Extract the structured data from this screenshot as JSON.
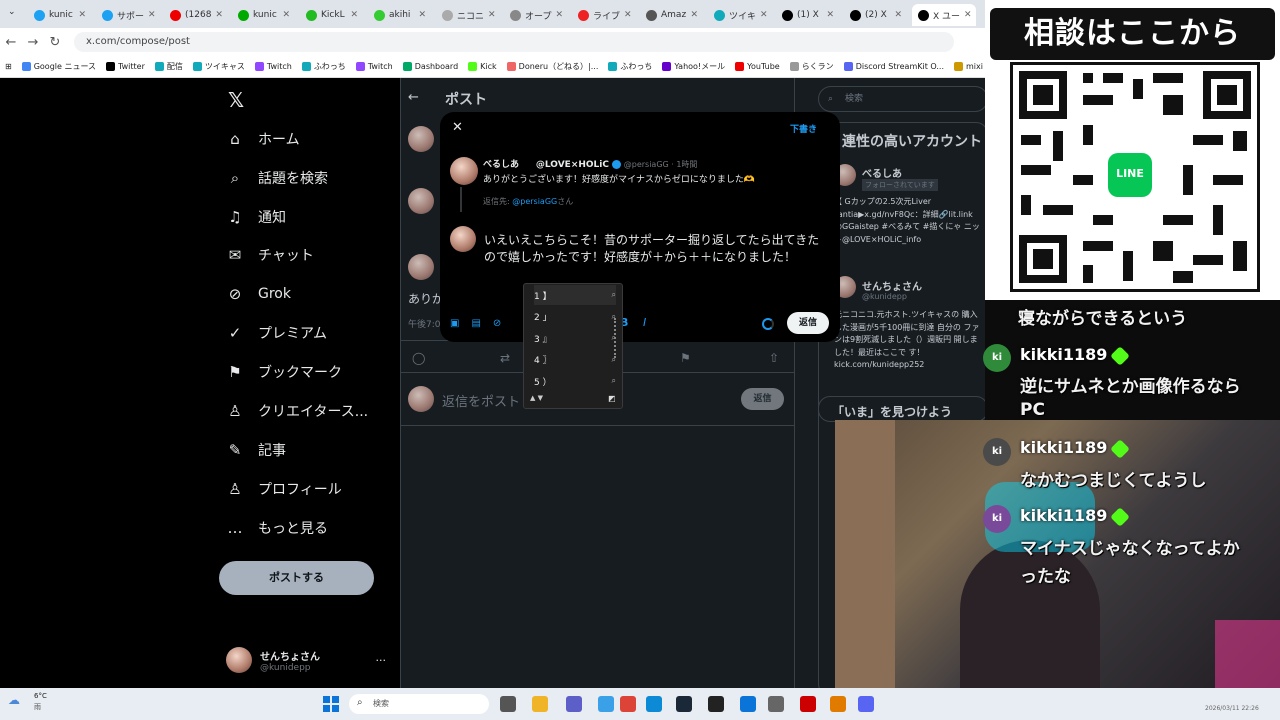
{
  "browser": {
    "tabs": [
      {
        "label": "kunic",
        "color": "#1da1f2"
      },
      {
        "label": "サポー",
        "color": "#1da1f2"
      },
      {
        "label": "(1268",
        "color": "#e00"
      },
      {
        "label": "kunic",
        "color": "#0a0"
      },
      {
        "label": "KickL",
        "color": "#2b2"
      },
      {
        "label": "akihi",
        "color": "#3c3"
      },
      {
        "label": "ニコニ",
        "color": "#aaa"
      },
      {
        "label": "オープ",
        "color": "#888"
      },
      {
        "label": "ライブ",
        "color": "#e22"
      },
      {
        "label": "Amaz",
        "color": "#555"
      },
      {
        "label": "ツイキ",
        "color": "#1ab"
      },
      {
        "label": "(1) X",
        "color": "#000"
      },
      {
        "label": "(2) X",
        "color": "#000"
      },
      {
        "label": "X ユー",
        "color": "#000"
      }
    ],
    "url": "x.com/compose/post",
    "bookmarks": [
      {
        "label": "Google ニュース",
        "color": "#4285f4"
      },
      {
        "label": "Twitter",
        "color": "#000"
      },
      {
        "label": "配信",
        "color": "#1ab"
      },
      {
        "label": "ツイキャス",
        "color": "#1ab"
      },
      {
        "label": "Twitch",
        "color": "#9146ff"
      },
      {
        "label": "ふわっち",
        "color": "#1ab"
      },
      {
        "label": "Twitch",
        "color": "#9146ff"
      },
      {
        "label": "Dashboard",
        "color": "#0a6"
      },
      {
        "label": "Kick",
        "color": "#53fc18"
      },
      {
        "label": "Doneru（どねる）|...",
        "color": "#e66"
      },
      {
        "label": "ふわっち",
        "color": "#1ab"
      },
      {
        "label": "Yahoo!メール",
        "color": "#60c"
      },
      {
        "label": "YouTube",
        "color": "#e00"
      },
      {
        "label": "らくラン",
        "color": "#999"
      },
      {
        "label": "Discord StreamKit O...",
        "color": "#5865f2"
      },
      {
        "label": "mixi",
        "color": "#c90"
      }
    ]
  },
  "nav": {
    "items": [
      {
        "label": "ホーム",
        "icon": "⌂"
      },
      {
        "label": "話題を検索",
        "icon": "⌕"
      },
      {
        "label": "通知",
        "icon": "♫"
      },
      {
        "label": "チャット",
        "icon": "✉"
      },
      {
        "label": "Grok",
        "icon": "⊘"
      },
      {
        "label": "プレミアム",
        "icon": "✓"
      },
      {
        "label": "ブックマーク",
        "icon": "⚑"
      },
      {
        "label": "クリエイタース...",
        "icon": "♙"
      },
      {
        "label": "記事",
        "icon": "✎"
      },
      {
        "label": "プロフィール",
        "icon": "♙"
      },
      {
        "label": "もっと見る",
        "icon": "…"
      }
    ],
    "post_button": "ポストする",
    "profile_name": "せんちょさん",
    "profile_handle": "@kunidepp",
    "more": "···"
  },
  "center": {
    "back": "←",
    "title": "ポスト",
    "fragment_text": "ありが",
    "time_fragment": "午後7:0",
    "reply_placeholder": "返信をポスト",
    "reply_button": "返信"
  },
  "right": {
    "search_placeholder": "検索",
    "section_title": "連性の高いアカウント",
    "account1_name": "べるしあ",
    "account1_follow": "フォローされています",
    "account1_bio": "【 Gカップの2.5次元Liver Fantia▶x.gd/nvF8Qc：詳細🔗lit.link @GGaistep #べるみて #描くにゃ ニット@LOVE×HOLiC_info",
    "account2_name": "せんちょさん",
    "account2_handle": "@kunidepp",
    "account2_bio": "元ニコニコ.元ホスト.ツイキャスの 購入した漫画が5千100冊に到達 自分の ファンは9割死滅しました（）週販円 開しました！最近はここで す！ kick.com/kunidepp252",
    "trend_title": "「いま」を見つけよう"
  },
  "modal": {
    "close": "✕",
    "draft": "下書き",
    "tweet_name": "べるしあ",
    "tweet_tag": "@LOVE×HOLiC",
    "tweet_handle": "@persiaGG · 1時間",
    "tweet_text": "ありがとうございます！好感度がマイナスからゼロになりました🫶",
    "replying_prefix": "返信先: ",
    "replying_handle": "@persiaGG",
    "replying_suffix": "さん",
    "compose_text": "いえいえこちらこそ！昔のサポーター掘り返してたら出てきたので嬉しかったです！好感度が＋から＋＋になりました！",
    "reply_button": "返信"
  },
  "ime": {
    "candidates": [
      "1 】",
      "2 」",
      "3 』",
      "4 〗",
      "5 ）"
    ]
  },
  "overlay": {
    "qr_title": "相談はここから",
    "line_label": "LINE",
    "chat_top": "寝ながらできるという",
    "messages": [
      {
        "user": "kikki1189",
        "text1": "逆にサムネとか画像作るなら",
        "text2": "PC"
      },
      {
        "user": "kikki1189",
        "text1": "なかむつまじくてようし",
        "text2": ""
      },
      {
        "user": "kikki1189",
        "text1": "マイナスじゃなくなってよか",
        "text2": "ったな"
      }
    ]
  },
  "taskbar": {
    "weather": "6°C",
    "weather_sub": "雨",
    "search_placeholder": "検索",
    "clock": "2026/03/11 22:26"
  }
}
